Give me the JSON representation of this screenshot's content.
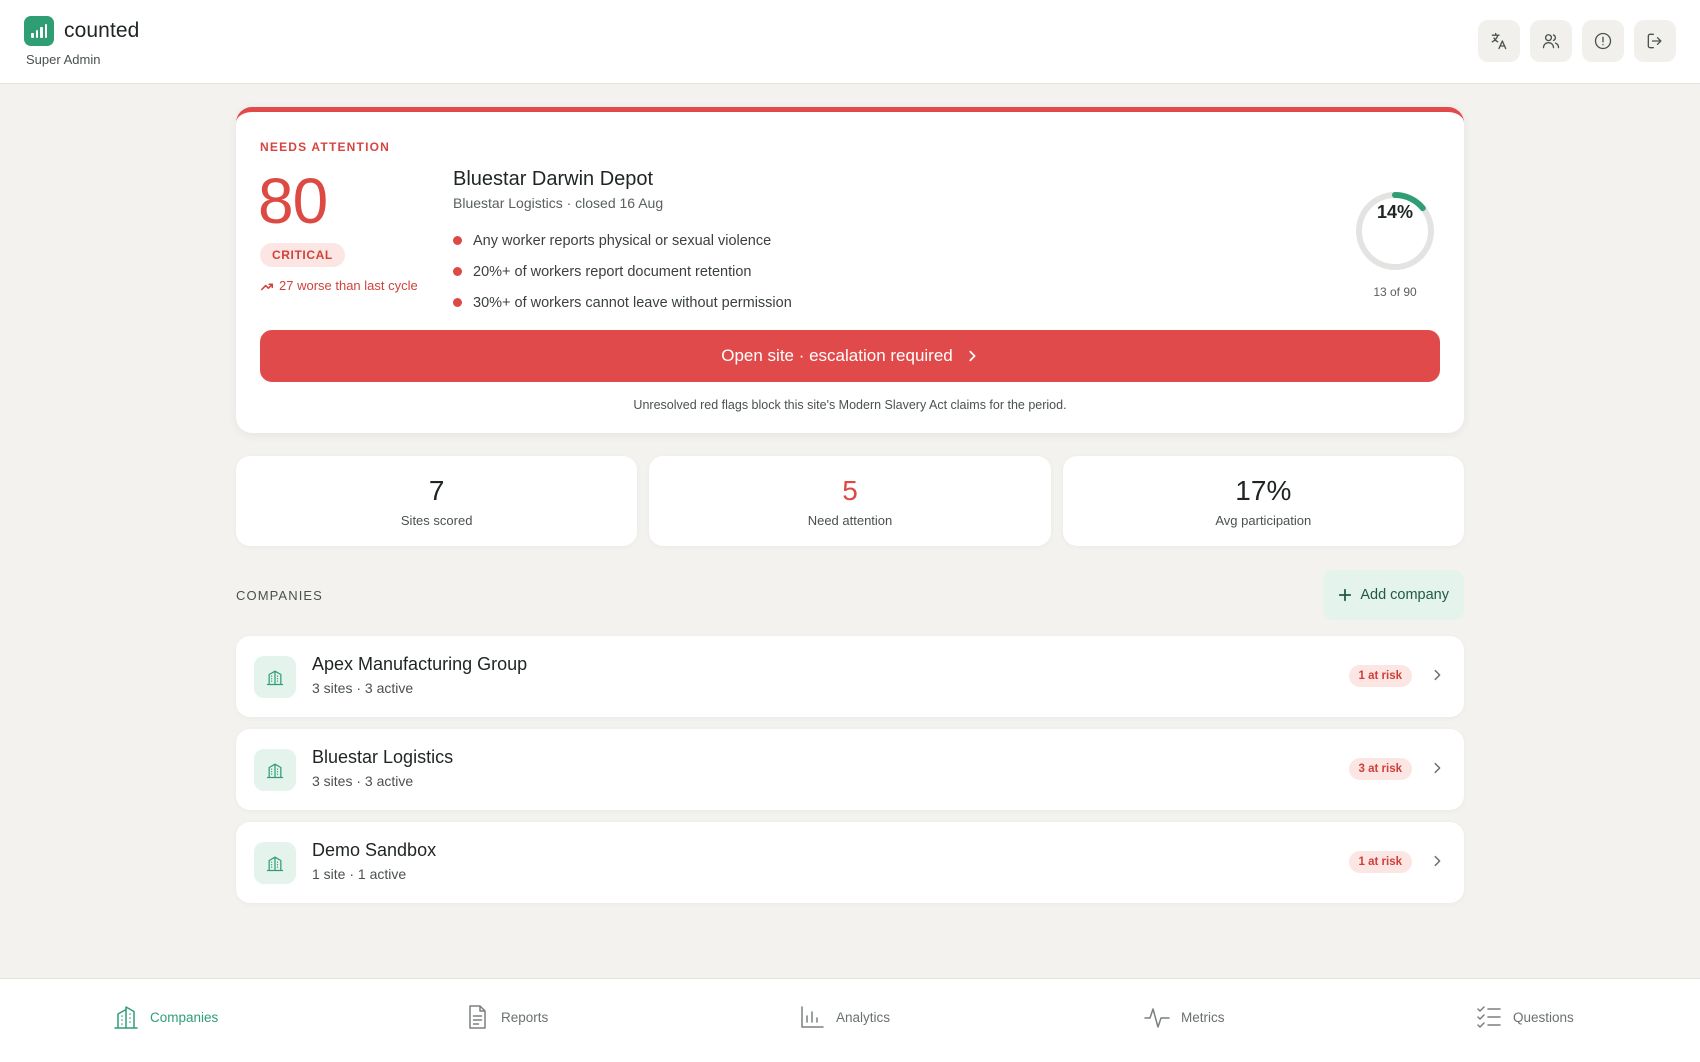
{
  "app": {
    "name": "counted",
    "role": "Super Admin"
  },
  "header_actions": [
    {
      "icon": "translate-icon"
    },
    {
      "icon": "users-icon"
    },
    {
      "icon": "info-icon"
    },
    {
      "icon": "logout-icon"
    }
  ],
  "attention": {
    "label": "NEEDS ATTENTION",
    "score": "80",
    "severity": "CRITICAL",
    "trend": "27 worse than last cycle",
    "site_name": "Bluestar Darwin Depot",
    "site_meta": "Bluestar Logistics · closed 16 Aug",
    "flags": [
      "Any worker reports physical or sexual violence",
      "20%+ of workers report document retention",
      "30%+ of workers cannot leave without permission"
    ],
    "participation": {
      "percent_label": "14%",
      "fraction": 0.14,
      "count_label": "13 of 90"
    },
    "cta": "Open site · escalation required",
    "note": "Unresolved red flags block this site's Modern Slavery Act claims for the period."
  },
  "stats": [
    {
      "value": "7",
      "label": "Sites scored"
    },
    {
      "value": "5",
      "label": "Need attention"
    },
    {
      "value": "17%",
      "label": "Avg participation"
    }
  ],
  "companies": {
    "title": "COMPANIES",
    "add_label": "Add company",
    "items": [
      {
        "name": "Apex Manufacturing Group",
        "meta": "3 sites · 3 active",
        "risk": "1 at risk"
      },
      {
        "name": "Bluestar Logistics",
        "meta": "3 sites · 3 active",
        "risk": "3 at risk"
      },
      {
        "name": "Demo Sandbox",
        "meta": "1 site · 1 active",
        "risk": "1 at risk"
      }
    ]
  },
  "nav": [
    {
      "label": "Companies",
      "icon": "building-icon",
      "active": true
    },
    {
      "label": "Reports",
      "icon": "document-icon",
      "active": false
    },
    {
      "label": "Analytics",
      "icon": "bar-chart-icon",
      "active": false
    },
    {
      "label": "Metrics",
      "icon": "pulse-icon",
      "active": false
    },
    {
      "label": "Questions",
      "icon": "checklist-icon",
      "active": false
    }
  ],
  "colors": {
    "brand": "#2f9e75",
    "alert": "#e14a4a"
  }
}
